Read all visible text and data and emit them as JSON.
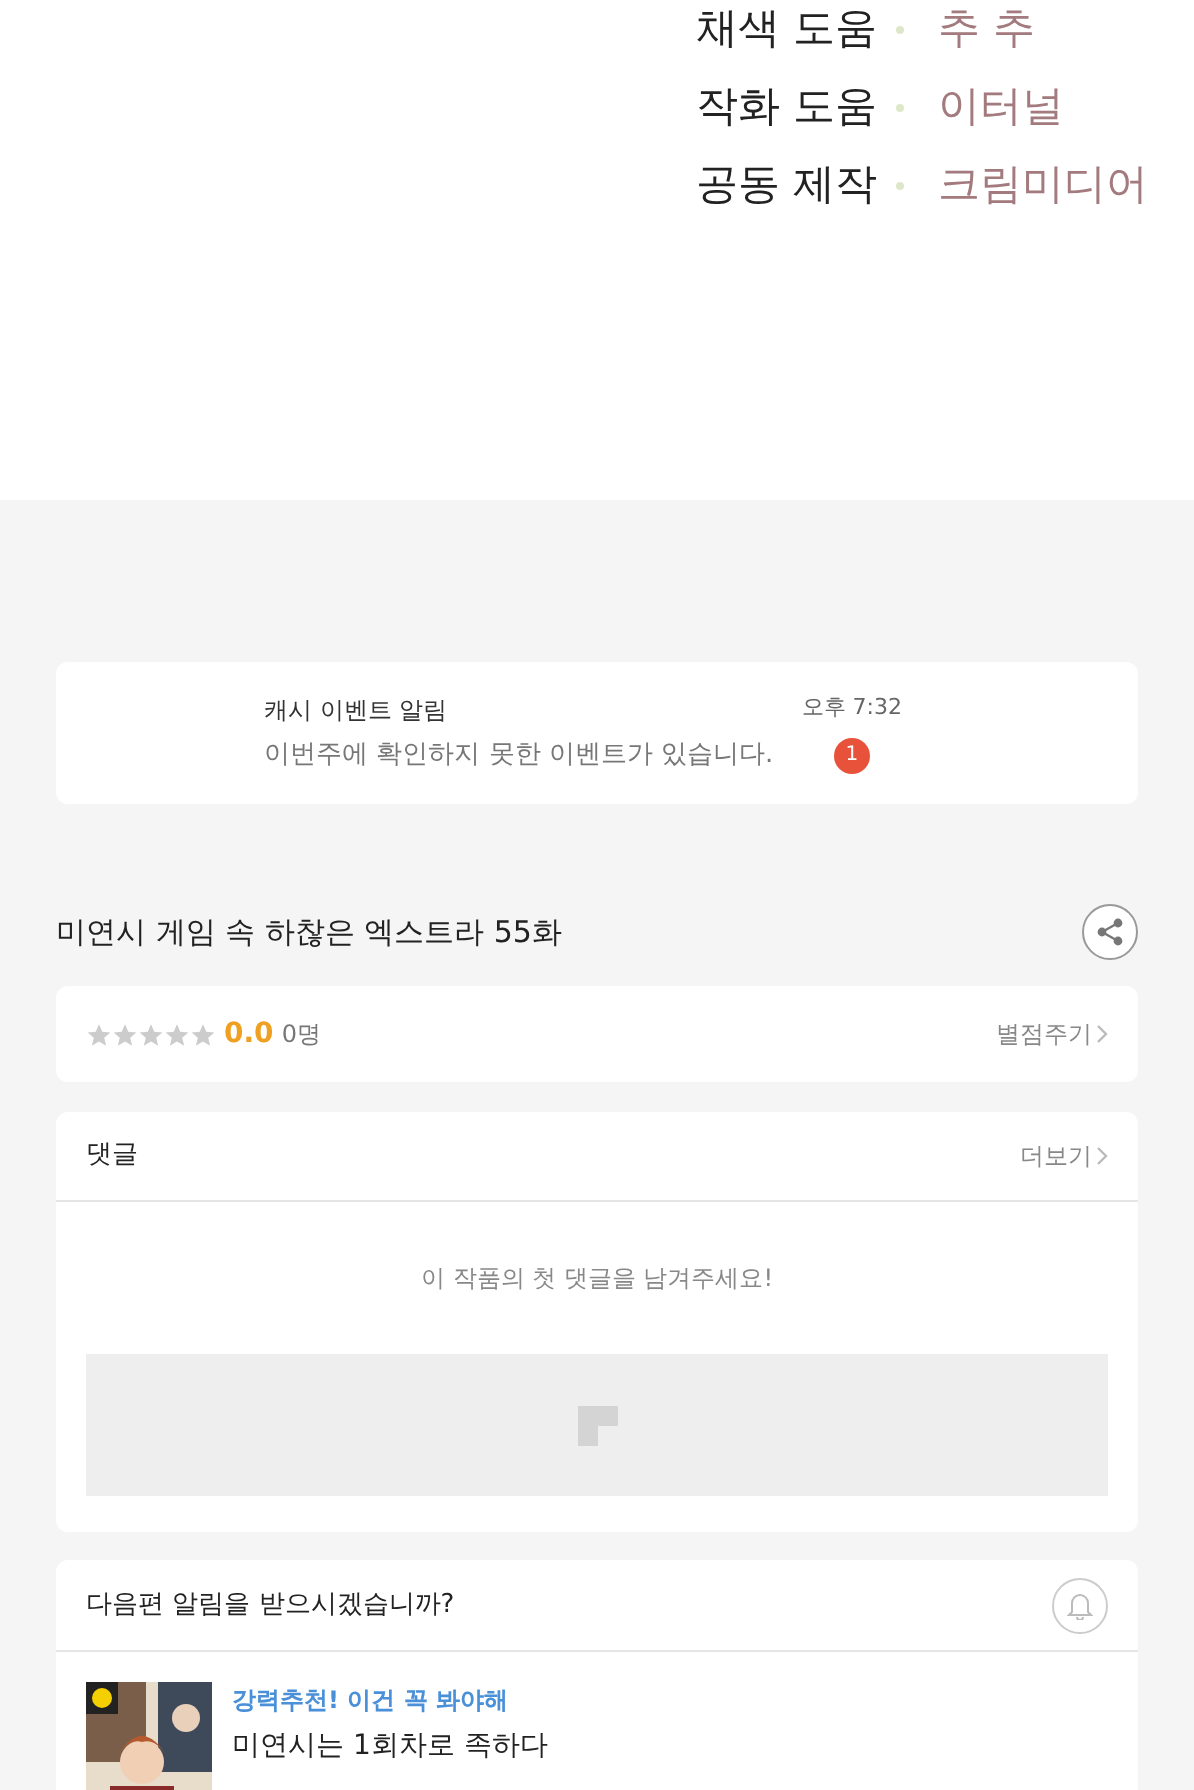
{
  "credits": [
    {
      "role": "채색 도움",
      "name": "추 추"
    },
    {
      "role": "작화 도움",
      "name": "이터널"
    },
    {
      "role": "공동 제작",
      "name": "크림미디어"
    }
  ],
  "notification": {
    "title": "캐시 이벤트 알림",
    "message": "이번주에 확인하지 못한 이벤트가 있습니다.",
    "time": "오후 7:32",
    "badge": "1"
  },
  "episode_title": "미연시 게임 속 하찮은 엑스트라 55화",
  "rating": {
    "stars": 0,
    "score": "0.0",
    "count": "0명",
    "action": "별점주기"
  },
  "comments": {
    "title": "댓글",
    "more": "더보기",
    "empty": "이 작품의 첫 댓글을 남겨주세요!"
  },
  "subscribe": {
    "question": "다음편 알림을 받으시겠습니까?",
    "on": false
  },
  "recommendation": {
    "tag": "강력추천! 이건 꼭 봐야해",
    "title": "미연시는 1회차로 족하다"
  }
}
